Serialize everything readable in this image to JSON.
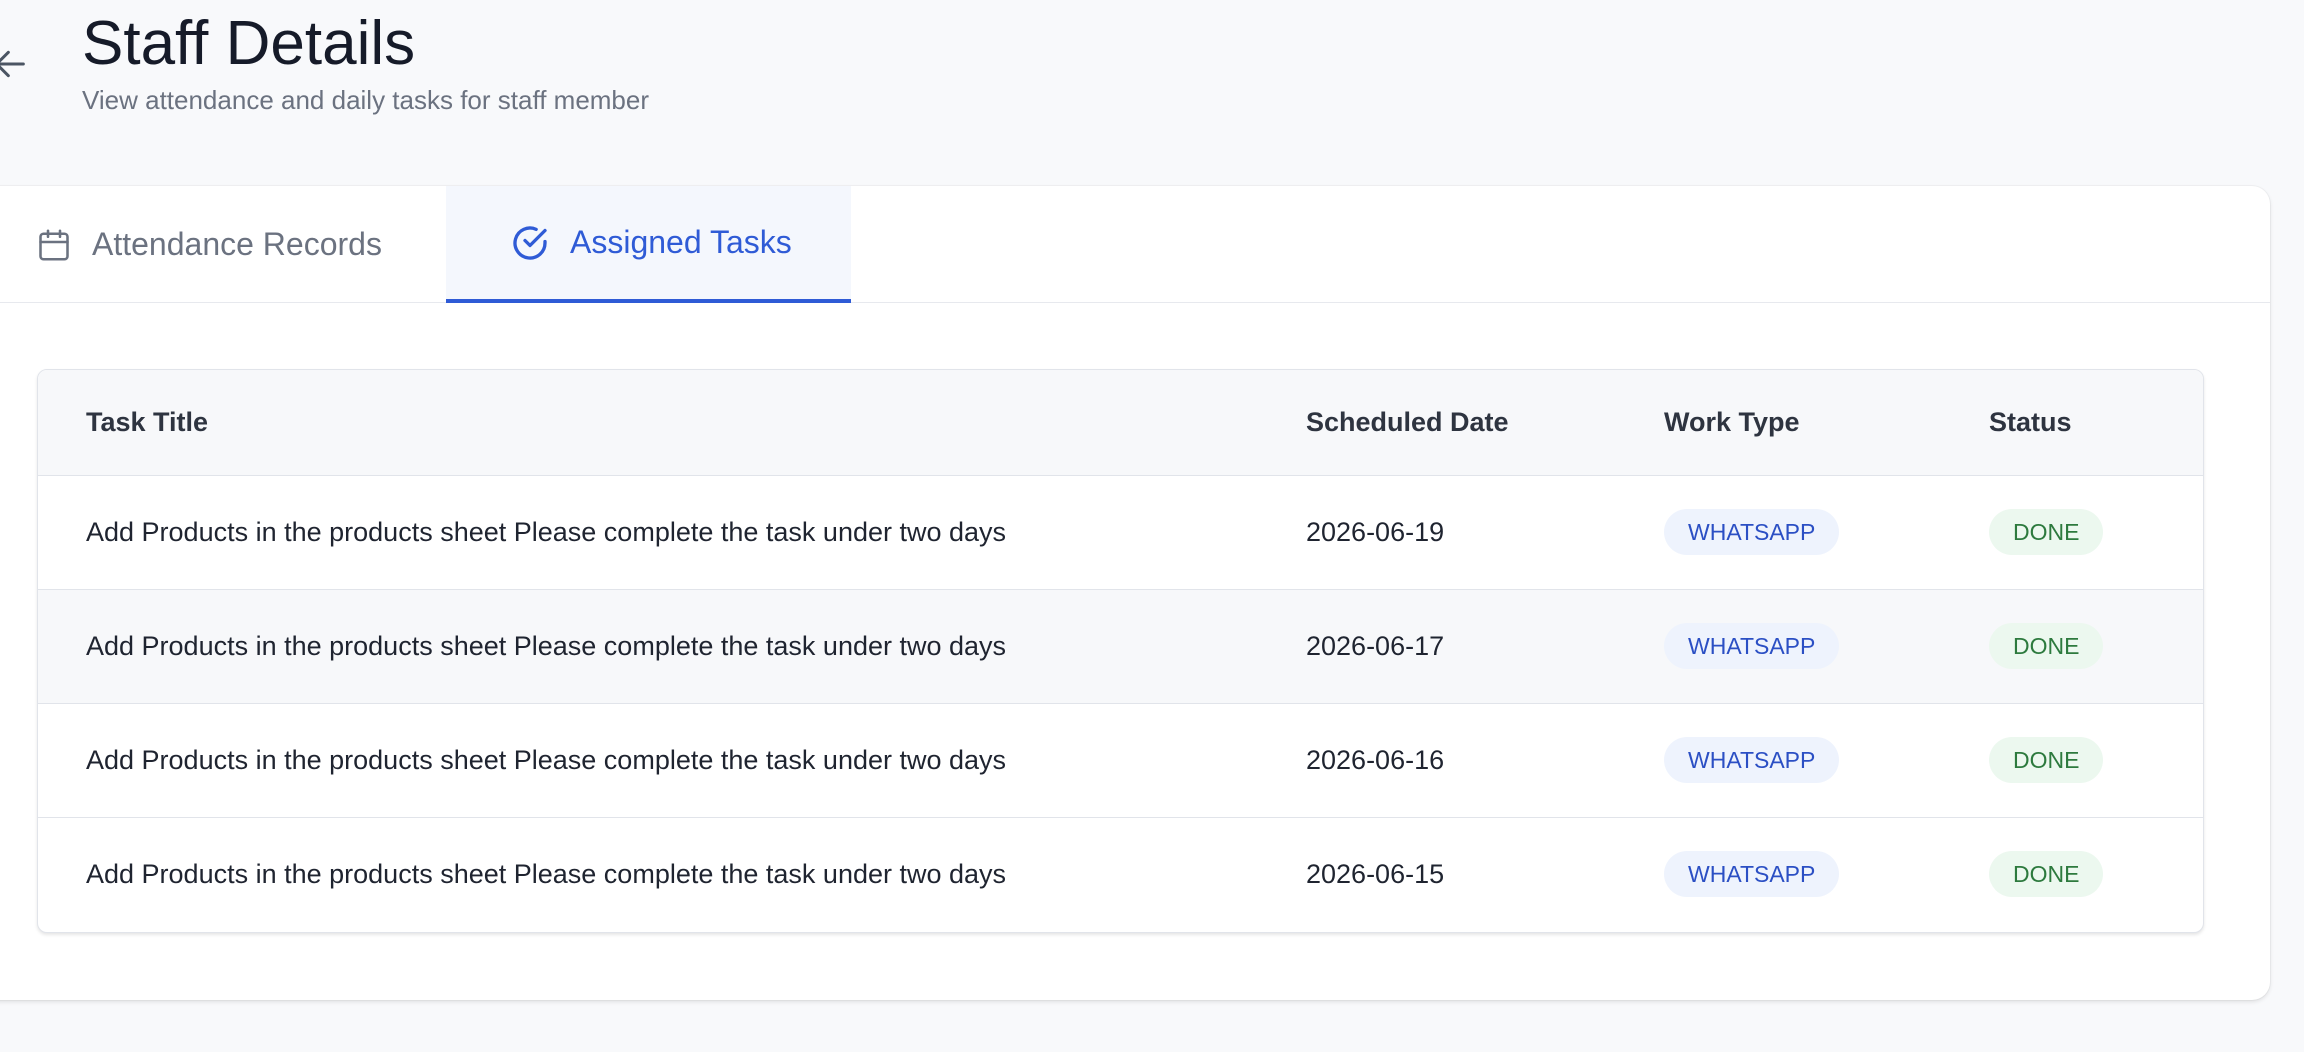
{
  "header": {
    "title": "Staff Details",
    "subtitle": "View attendance and daily tasks for staff member",
    "back_icon": "arrow-left-icon"
  },
  "tabs": [
    {
      "label": "Attendance Records",
      "icon": "calendar-icon",
      "active": false
    },
    {
      "label": "Assigned Tasks",
      "icon": "check-circle-icon",
      "active": true
    }
  ],
  "table": {
    "columns": [
      "Task Title",
      "Scheduled Date",
      "Work Type",
      "Status"
    ],
    "rows": [
      {
        "title": "Add Products in the products sheet Please complete the task under two days",
        "date": "2026-06-19",
        "work_type": "WHATSAPP",
        "status": "DONE"
      },
      {
        "title": "Add Products in the products sheet Please complete the task under two days",
        "date": "2026-06-17",
        "work_type": "WHATSAPP",
        "status": "DONE"
      },
      {
        "title": "Add Products in the products sheet Please complete the task under two days",
        "date": "2026-06-16",
        "work_type": "WHATSAPP",
        "status": "DONE"
      },
      {
        "title": "Add Products in the products sheet Please complete the task under two days",
        "date": "2026-06-15",
        "work_type": "WHATSAPP",
        "status": "DONE"
      }
    ]
  },
  "colors": {
    "accent": "#2f5bd6",
    "work_type_badge_bg": "#eef3fd",
    "work_type_badge_text": "#2b4fc4",
    "status_badge_bg": "#ecf8ef",
    "status_badge_text": "#2d7a3e"
  }
}
